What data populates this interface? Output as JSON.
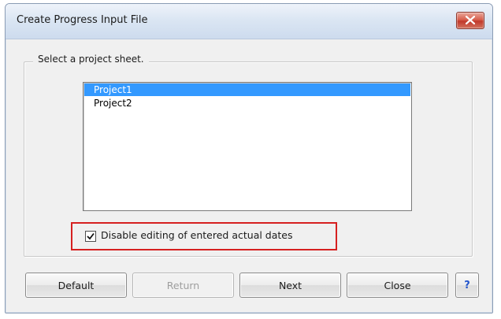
{
  "window": {
    "title": "Create Progress Input File"
  },
  "group": {
    "legend": "Select a project sheet."
  },
  "list": {
    "items": [
      "Project1",
      "Project2"
    ],
    "selected_index": 0
  },
  "option": {
    "label": "Disable editing of entered actual dates",
    "checked": true
  },
  "buttons": {
    "default_label": "Default",
    "return_label": "Return",
    "next_label": "Next",
    "close_label": "Close",
    "help_label": "?"
  },
  "icons": {
    "close": "close-icon",
    "check": "checkmark-icon"
  },
  "colors": {
    "selection": "#3399ff",
    "highlight_box": "#d62020",
    "close_button": "#c0392b"
  }
}
